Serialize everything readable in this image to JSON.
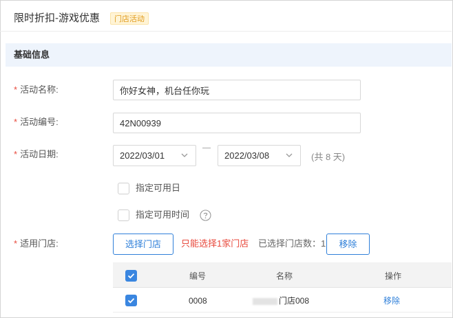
{
  "header": {
    "title": "限时折扣-游戏优惠",
    "badge": "门店活动"
  },
  "section": {
    "title": "基础信息"
  },
  "form": {
    "required_mark": "*",
    "name": {
      "label": "活动名称:",
      "value": "你好女神，机台任你玩"
    },
    "code": {
      "label": "活动编号:",
      "value": "42N00939"
    },
    "date": {
      "label": "活动日期:",
      "start": "2022/03/01",
      "end": "2022/03/08",
      "separator": "—",
      "duration": "(共 8 天)"
    },
    "specify_days": {
      "label": "指定可用日",
      "checked": false
    },
    "specify_time": {
      "label": "指定可用时间",
      "checked": false,
      "help_icon": "question-circle-icon"
    },
    "stores": {
      "label": "适用门店:",
      "select_button": "选择门店",
      "warning": "只能选择1家门店",
      "selected_count": "已选择门店数：1",
      "remove_button": "移除"
    }
  },
  "table": {
    "columns": [
      "编号",
      "名称",
      "操作"
    ],
    "rows": [
      {
        "checked": true,
        "code": "0008",
        "name": "门店008",
        "action": "移除"
      }
    ]
  },
  "colors": {
    "accent": "#2e7fd9",
    "required": "#e84a3d",
    "badge_bg": "#fff4d6",
    "badge_text": "#e09a1c",
    "section_bg": "#eef4fc"
  }
}
